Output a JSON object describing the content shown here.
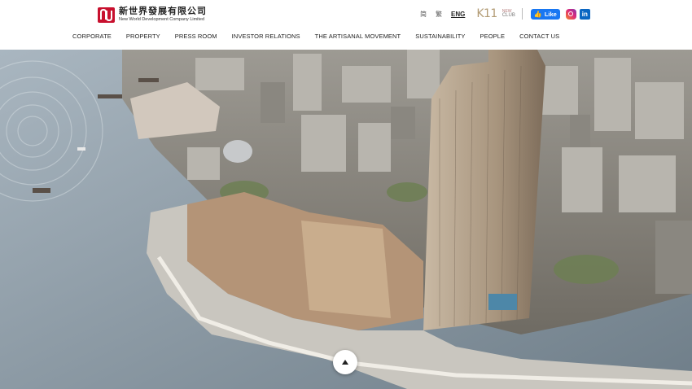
{
  "brand": {
    "name_cn": "新世界發展有限公司",
    "name_en": "New World Development Company Limited",
    "accent": "#c8102e"
  },
  "utility": {
    "languages": [
      "简",
      "繁",
      "ENG"
    ],
    "active_language": "ENG",
    "k11_label": "K11",
    "club_label_top": "NEW",
    "club_label_bottom": "CLUB",
    "facebook_like": "Like"
  },
  "nav": {
    "items": [
      "CORPORATE",
      "PROPERTY",
      "PRESS ROOM",
      "INVESTOR RELATIONS",
      "THE ARTISANAL MOVEMENT",
      "SUSTAINABILITY",
      "PEOPLE",
      "CONTACT US"
    ]
  },
  "hero": {
    "description": "Aerial view of harbourfront development with skyscraper"
  },
  "icons": {
    "facebook": "facebook-icon",
    "instagram": "instagram-icon",
    "linkedin": "linkedin-icon",
    "back_to_top": "arrow-up-icon"
  }
}
